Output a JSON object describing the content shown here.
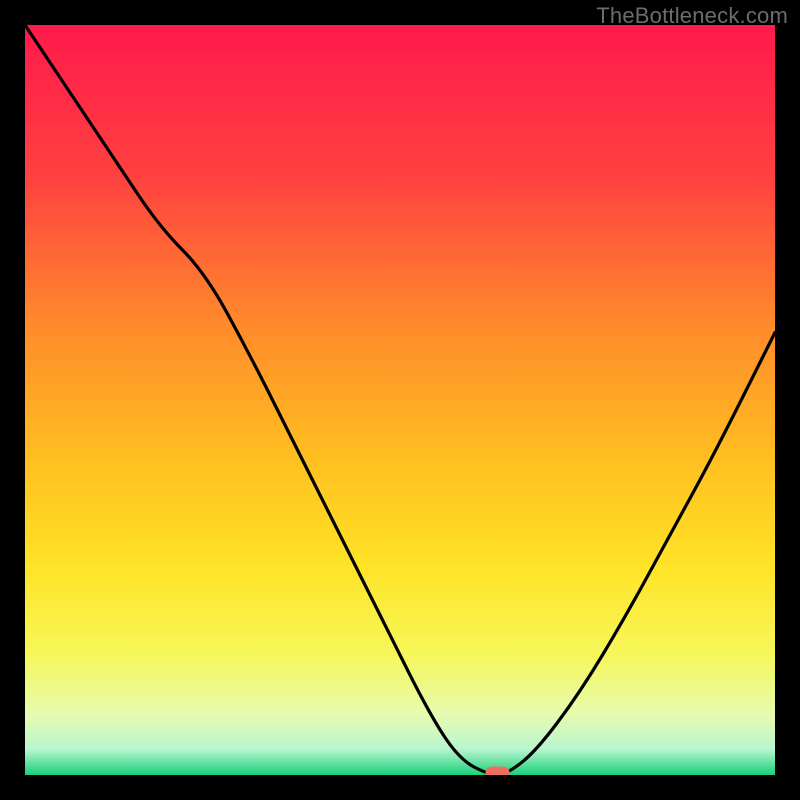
{
  "watermark": "TheBottleneck.com",
  "chart_data": {
    "type": "line",
    "x": [
      0.0,
      0.06,
      0.12,
      0.18,
      0.24,
      0.3,
      0.36,
      0.42,
      0.48,
      0.54,
      0.58,
      0.62,
      0.64,
      0.68,
      0.74,
      0.8,
      0.86,
      0.92,
      1.0
    ],
    "y": [
      1.0,
      0.91,
      0.82,
      0.73,
      0.67,
      0.56,
      0.44,
      0.32,
      0.2,
      0.08,
      0.02,
      0.0,
      0.0,
      0.03,
      0.11,
      0.21,
      0.32,
      0.43,
      0.59
    ],
    "xlim": [
      0,
      1
    ],
    "ylim": [
      0,
      1
    ],
    "title": "",
    "xlabel": "",
    "ylabel": "",
    "marker": {
      "x": 0.63,
      "y": 0.0
    },
    "background_gradient": {
      "stops": [
        {
          "offset": 0.0,
          "color": "#ff1a4c"
        },
        {
          "offset": 0.2,
          "color": "#ff4040"
        },
        {
          "offset": 0.4,
          "color": "#ff8a2b"
        },
        {
          "offset": 0.58,
          "color": "#ffbf20"
        },
        {
          "offset": 0.72,
          "color": "#ffe326"
        },
        {
          "offset": 0.84,
          "color": "#f6f75a"
        },
        {
          "offset": 0.92,
          "color": "#e6fbb0"
        },
        {
          "offset": 0.965,
          "color": "#b9f6cf"
        },
        {
          "offset": 1.0,
          "color": "#19d07a"
        }
      ]
    }
  }
}
